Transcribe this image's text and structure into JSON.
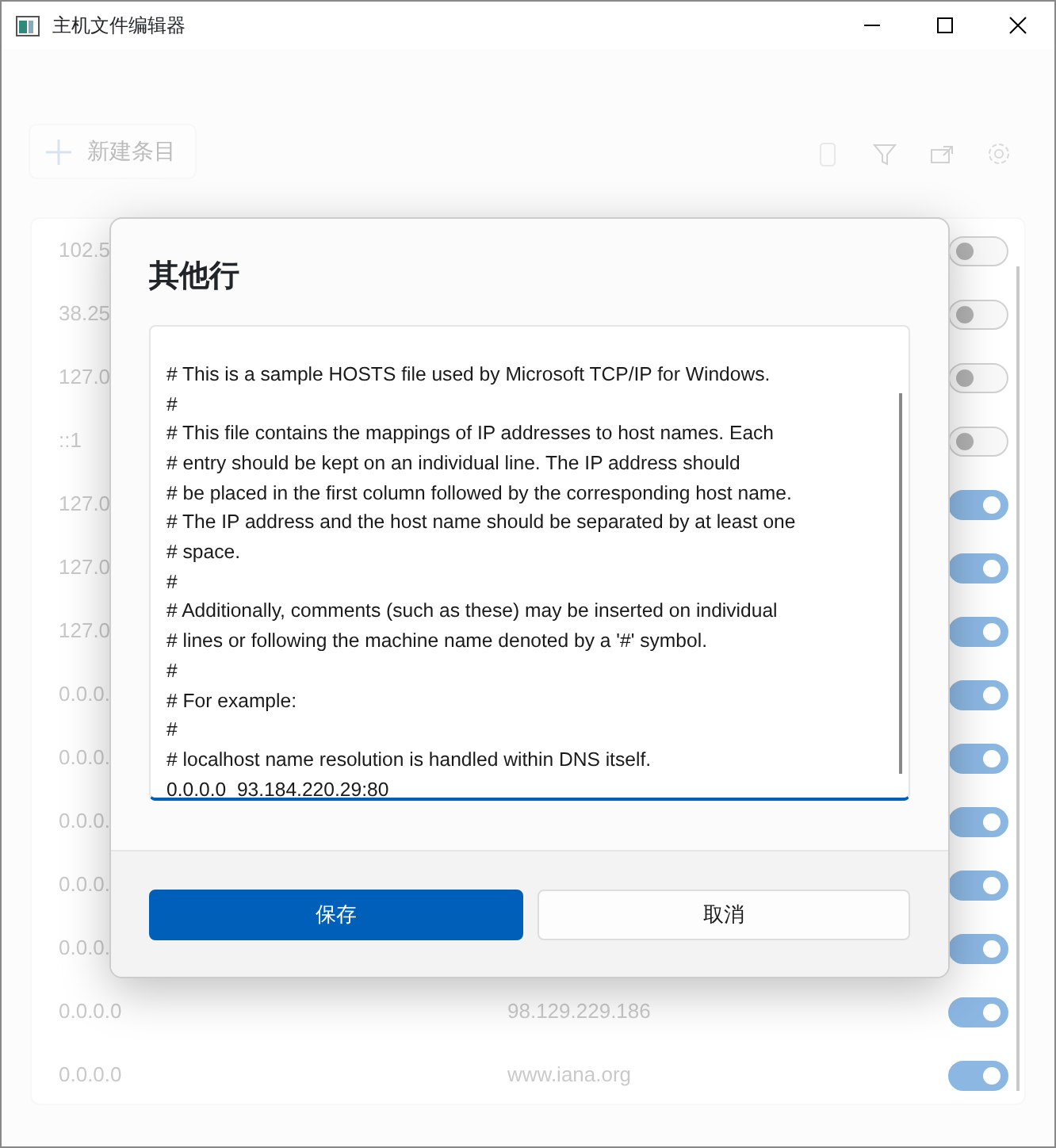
{
  "window": {
    "title": "主机文件编辑器"
  },
  "toolbar": {
    "new_entry": "新建条目"
  },
  "entries": [
    {
      "address": "102.5",
      "enabled": false
    },
    {
      "address": "38.25",
      "enabled": false
    },
    {
      "address": "127.0",
      "enabled": false
    },
    {
      "address": "::1",
      "enabled": false
    },
    {
      "address": "127.0",
      "enabled": true
    },
    {
      "address": "127.0",
      "enabled": true
    },
    {
      "address": "127.0",
      "enabled": true
    },
    {
      "address": "0.0.0.",
      "enabled": true
    },
    {
      "address": "0.0.0.",
      "enabled": true
    },
    {
      "address": "0.0.0.",
      "enabled": true
    },
    {
      "address": "0.0.0.",
      "enabled": true
    },
    {
      "address": "0.0.0.",
      "enabled": true
    },
    {
      "address": "0.0.0.0",
      "host": "98.129.229.186",
      "enabled": true
    },
    {
      "address": "0.0.0.0",
      "host": "www.iana.org",
      "enabled": true
    }
  ],
  "dialog": {
    "title": "其他行",
    "text_lines": [
      "# This is a sample HOSTS file used by Microsoft TCP/IP for Windows.",
      "#",
      "# This file contains the mappings of IP addresses to host names. Each",
      "# entry should be kept on an individual line. The IP address should",
      "# be placed in the first column followed by the corresponding host name.",
      "# The IP address and the host name should be separated by at least one",
      "# space.",
      "#",
      "# Additionally, comments (such as these) may be inserted on individual",
      "# lines or following the machine name denoted by a '#' symbol.",
      "#",
      "# For example:",
      "#",
      "# localhost name resolution is handled within DNS itself.",
      "0.0.0.0  93.184.220.29:80"
    ],
    "buttons": [
      {
        "label": "保存",
        "kind": "primary"
      },
      {
        "label": "取消",
        "kind": "secondary"
      }
    ]
  }
}
